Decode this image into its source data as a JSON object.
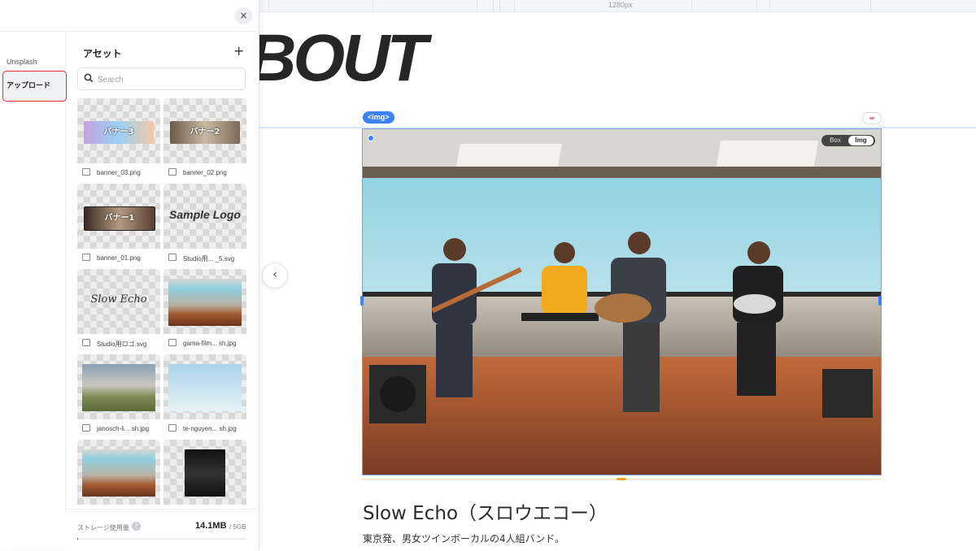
{
  "canvas": {
    "ruler_label": "1280px",
    "page_heading": "ABOUT",
    "element_tag": "<img>",
    "link_badge": "⇹",
    "toggle": {
      "box_label": "Box",
      "img_label": "Img",
      "selected": "Img"
    },
    "band_title": "Slow Echo（スロウエコー）",
    "band_description": "東京発、男女ツインボーカルの4人組バンド。"
  },
  "panel": {
    "close_icon": "×",
    "sources": [
      {
        "label": "Unsplash",
        "selected": false
      },
      {
        "label": "アップロード",
        "selected": true
      }
    ],
    "assets_title": "アセット",
    "add_icon": "+",
    "search_placeholder": "Search",
    "search_value": "",
    "assets": [
      {
        "name": "banner_03.png",
        "thumb_text": "バナー3"
      },
      {
        "name": "banner_02.png",
        "thumb_text": "バナー2"
      },
      {
        "name": "banner_01.png",
        "thumb_text": "バナー1"
      },
      {
        "name": "Studio用... _5.svg",
        "thumb_text": "Sample Logo"
      },
      {
        "name": "Studio用ロゴ.svg",
        "thumb_text": "Slow Echo"
      },
      {
        "name": "gama-film... sh.jpg",
        "thumb_text": ""
      },
      {
        "name": "janosch-li... sh.jpg",
        "thumb_text": ""
      },
      {
        "name": "te-nguyen... sh.jpg",
        "thumb_text": ""
      },
      {
        "name": "",
        "thumb_text": ""
      },
      {
        "name": "",
        "thumb_text": ""
      }
    ],
    "storage": {
      "label": "ストレージ使用量",
      "help_icon": "?",
      "used": "14.1MB",
      "total": "/ 5GB",
      "used_fraction": 0.003
    },
    "collapse_icon": "‹"
  },
  "colors": {
    "accent": "#3b82f6",
    "selection_outline": "#e0332c",
    "bottom_handle": "#f5a524"
  }
}
